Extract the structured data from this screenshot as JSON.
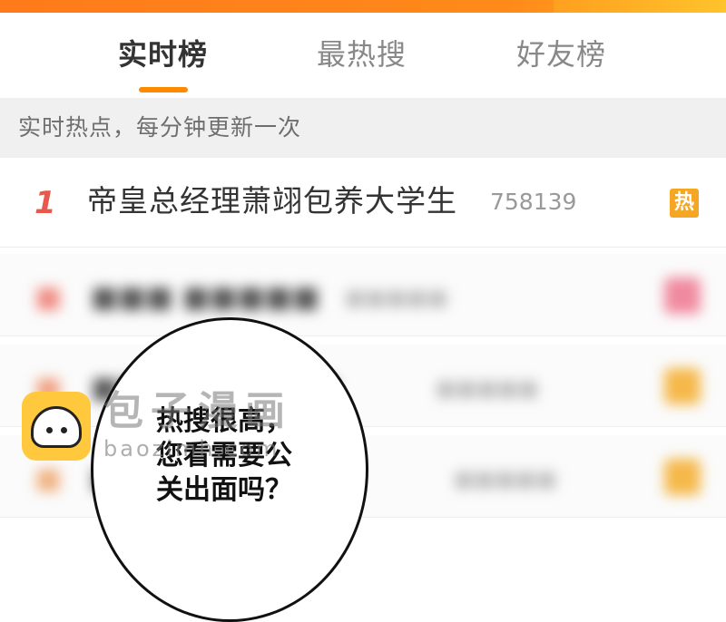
{
  "tabs": [
    {
      "label": "实时榜",
      "active": true
    },
    {
      "label": "最热搜",
      "active": false
    },
    {
      "label": "好友榜",
      "active": false
    }
  ],
  "subheader": "实时热点，每分钟更新一次",
  "top_item": {
    "rank": "1",
    "title": "帝皇总经理萧翊包养大学生",
    "count": "758139",
    "badge": "热"
  },
  "comic_bubble": {
    "lines": [
      "热搜很高，",
      "您看需要公",
      "关出面吗？"
    ]
  },
  "watermark": {
    "title": "包子漫画",
    "subtitle": "baozimh.com"
  },
  "colors": {
    "accent": "#ff8a00",
    "rank_red": "#e8594d",
    "hot_badge": "#f5a623",
    "logo_yellow": "#ffc83d"
  }
}
